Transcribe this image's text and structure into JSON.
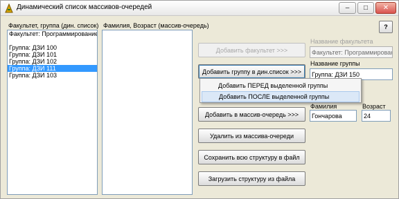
{
  "window": {
    "title": "Динамический список массивов-очередей",
    "controls": {
      "minimize": "–",
      "maximize": "□",
      "close": "✕"
    },
    "help_label": "?"
  },
  "faculty_panel": {
    "header": "Факультет, группа (дин. список)",
    "items": [
      {
        "label": "Факультет: Программирование",
        "selected": false
      },
      {
        "label": "",
        "selected": false
      },
      {
        "label": "Группа: ДЗИ 100",
        "selected": false
      },
      {
        "label": "Группа: ДЗИ 101",
        "selected": false
      },
      {
        "label": "Группа: ДЗИ 102",
        "selected": false
      },
      {
        "label": "Группа: ДЗИ 111",
        "selected": true
      },
      {
        "label": "Группа: ДЗИ 103",
        "selected": false
      }
    ]
  },
  "students_panel": {
    "header": "Фамилия, Возраст (массив-очередь)"
  },
  "buttons": {
    "add_faculty": "Добавить факультет >>>",
    "add_group": "Добавить группу в дин.список >>>",
    "add_to_queue": "Добавить в массив-очередь >>>",
    "remove_from_queue": "Удалить из массива-очереди",
    "save_structure": "Сохранить всю структуру в файл",
    "load_structure": "Загрузить структуру из файла"
  },
  "context_menu": {
    "items": [
      {
        "label": "Добавить ПЕРЕД выделенной группы",
        "hover": false
      },
      {
        "label": "Добавить ПОСЛЕ выделенной группы",
        "hover": true
      }
    ]
  },
  "form": {
    "faculty_name_label": "Название факультета",
    "faculty_name_value": "Факультет: Программирование",
    "group_name_label": "Название группы",
    "group_name_value": "Группа: ДЗИ 150",
    "surname_label": "Фамилия",
    "surname_value": "Гончарова",
    "age_label": "Возраст",
    "age_value": "24"
  }
}
